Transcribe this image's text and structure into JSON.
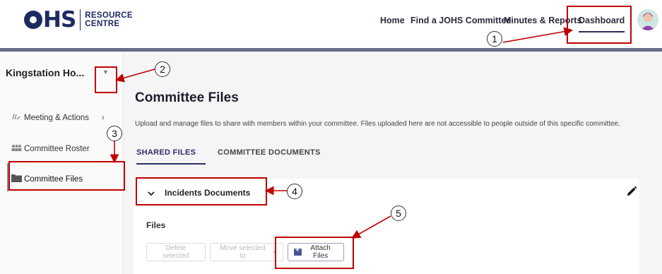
{
  "logo": {
    "mark": "OHS",
    "line1": "RESOURCE",
    "line2": "CENTRE"
  },
  "nav": {
    "items": [
      {
        "label": "Home"
      },
      {
        "label": "Find a JOHS Committee"
      },
      {
        "label": "Minutes & Reports"
      },
      {
        "label": "Dashboard",
        "active": true
      }
    ]
  },
  "sidebar": {
    "committee_name": "Kingstation Ho...",
    "items": [
      {
        "label": "Meeting & Actions",
        "icon": "meeting-icon"
      },
      {
        "label": "Committee Roster",
        "icon": "roster-icon"
      },
      {
        "label": "Committee Files",
        "icon": "folder-icon",
        "active": true
      }
    ]
  },
  "main": {
    "title": "Committee Files",
    "description": "Upload and manage files to share with members within your committee. Files uploaded here are not accessible to people outside of this specific committee.",
    "tabs": [
      {
        "label": "SHARED FILES",
        "active": true
      },
      {
        "label": "COMMITTEE DOCUMENTS"
      }
    ],
    "card": {
      "title": "Incidents Documents",
      "files_label": "Files",
      "buttons": {
        "delete": "Delete selected",
        "move": "Move selected to",
        "attach": "Attach Files"
      }
    }
  },
  "annotations": {
    "n1": "1",
    "n2": "2",
    "n3": "3",
    "n4": "4",
    "n5": "5"
  },
  "colors": {
    "accent": "#2d2d6a",
    "highlight": "#c00000",
    "brand": "#1d2b63"
  }
}
